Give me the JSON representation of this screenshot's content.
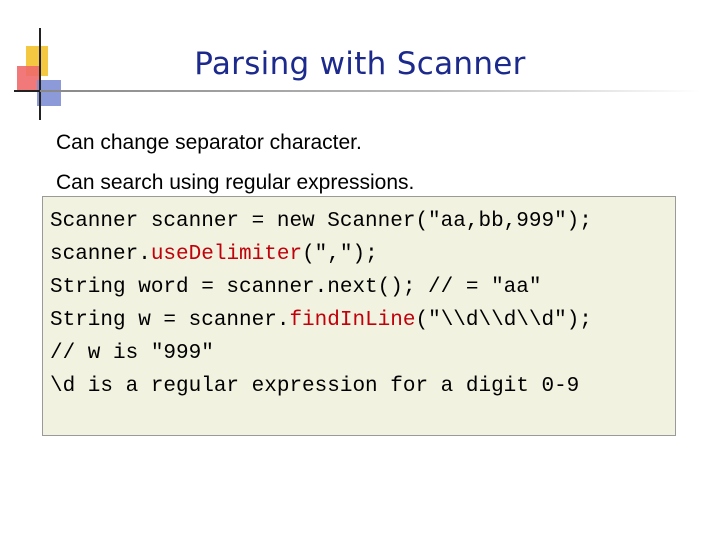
{
  "slide": {
    "title": "Parsing with Scanner",
    "bullets": [
      "Can change separator character.",
      "Can search using regular expressions."
    ],
    "code": {
      "line1": "Scanner scanner = new Scanner(\"aa,bb,999\");",
      "line2_pre": "scanner.",
      "line2_method": "useDelimiter",
      "line2_post": "(\",\");",
      "line3": "String word = scanner.next(); // = \"aa\"",
      "line4_pre": "String w = scanner.",
      "line4_method": "findInLine",
      "line4_post": "(\"\\\\d\\\\d\\\\d\");",
      "line5": "// w is \"999\"",
      "line6": "\\d is a regular expression for a digit 0-9"
    },
    "colors": {
      "title": "#1b2a8c",
      "method_highlight": "#c0000a",
      "code_background": "#f2f2e0"
    }
  }
}
